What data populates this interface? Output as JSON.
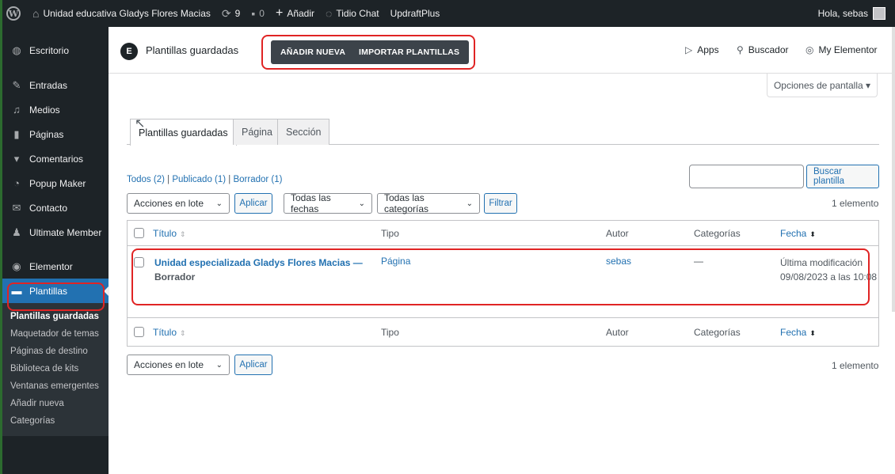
{
  "adminbar": {
    "site_name": "Unidad educativa Gladys Flores Macias",
    "updates_count": "9",
    "comments_count": "0",
    "add_new": "Añadir",
    "tidio": "Tidio Chat",
    "updraft": "UpdraftPlus",
    "greeting": "Hola, sebas"
  },
  "sidebar": {
    "items": [
      {
        "label": "Escritorio",
        "icon": "dashboard-icon"
      },
      {
        "label": "Entradas",
        "icon": "pin-icon"
      },
      {
        "label": "Medios",
        "icon": "media-icon"
      },
      {
        "label": "Páginas",
        "icon": "pages-icon"
      },
      {
        "label": "Comentarios",
        "icon": "comment-icon"
      },
      {
        "label": "Popup Maker",
        "icon": "popup-icon"
      },
      {
        "label": "Contacto",
        "icon": "mail-icon"
      },
      {
        "label": "Ultimate Member",
        "icon": "user-icon"
      },
      {
        "label": "Elementor",
        "icon": "elementor-icon"
      },
      {
        "label": "Plantillas",
        "icon": "folder-icon"
      }
    ],
    "submenu": [
      "Plantillas guardadas",
      "Maquetador de temas",
      "Páginas de destino",
      "Biblioteca de kits",
      "Ventanas emergentes",
      "Añadir nueva",
      "Categorías"
    ]
  },
  "header": {
    "title": "Plantillas guardadas",
    "add_new_button": "AÑADIR NUEVA",
    "import_button": "IMPORTAR PLANTILLAS",
    "apps": "Apps",
    "finder": "Buscador",
    "my_elementor": "My Elementor",
    "screen_options": "Opciones de pantalla ▾"
  },
  "tabs": [
    "Plantillas guardadas",
    "Página",
    "Sección"
  ],
  "filters": {
    "all": "Todos (2)",
    "published": "Publicado (1)",
    "draft": "Borrador (1)",
    "search_button": "Buscar plantilla",
    "bulk_actions": "Acciones en lote",
    "apply": "Aplicar",
    "all_dates": "Todas las fechas",
    "all_categories": "Todas las categorías",
    "filter": "Filtrar",
    "count": "1 elemento"
  },
  "table": {
    "columns": [
      "Título",
      "Tipo",
      "Autor",
      "Categorías",
      "Fecha"
    ],
    "rows": [
      {
        "title": "Unidad especializada Gladys Flores Macias —",
        "state": "Borrador",
        "type": "Página",
        "author": "sebas",
        "categories": "—",
        "date_label": "Última modificación",
        "date": "09/08/2023 a las 10:08"
      }
    ]
  },
  "colors": {
    "admin_dark": "#1d2327",
    "accent": "#2271b1",
    "highlight": "#e02424"
  }
}
